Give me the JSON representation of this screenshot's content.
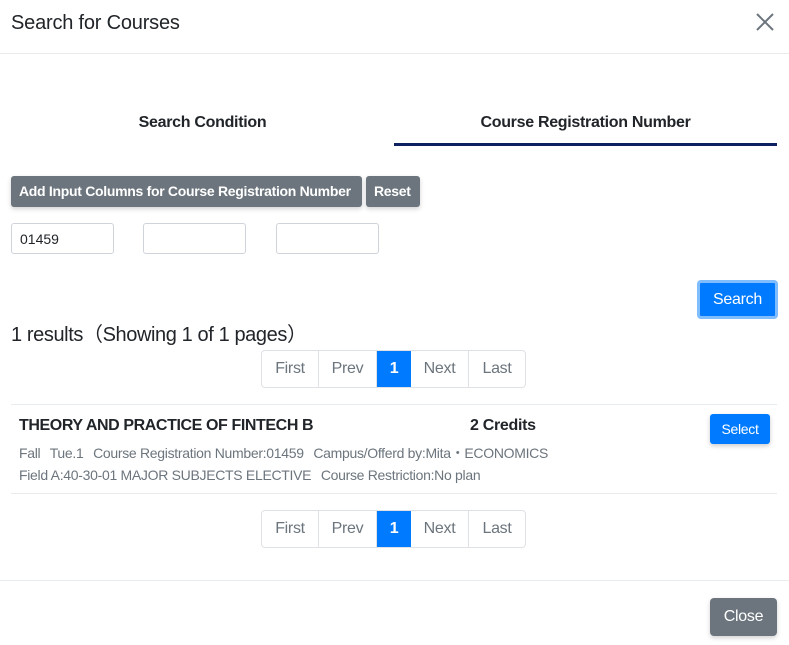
{
  "modal": {
    "title": "Search for Courses",
    "close_icon": "close-x-icon"
  },
  "tabs": [
    {
      "label": "Search Condition",
      "active": false
    },
    {
      "label": "Course Registration Number",
      "active": true
    }
  ],
  "toolbar": {
    "add_columns_label": "Add Input Columns for Course Registration Number",
    "reset_label": "Reset"
  },
  "inputs": [
    {
      "value": "01459",
      "placeholder": ""
    },
    {
      "value": "",
      "placeholder": ""
    },
    {
      "value": "",
      "placeholder": ""
    }
  ],
  "search": {
    "label": "Search"
  },
  "results": {
    "summary": "1 results（Showing 1 of 1 pages）"
  },
  "pagination": {
    "first": "First",
    "prev": "Prev",
    "current": "1",
    "next": "Next",
    "last": "Last"
  },
  "courses": [
    {
      "title": "THEORY AND PRACTICE OF FINTECH B",
      "credits": "2 Credits",
      "term": "Fall",
      "period": "Tue.1",
      "registration_number": "Course Registration Number:01459",
      "campus": "Campus/Offerd by:Mita・ECONOMICS",
      "field": "Field A:40-30-01 MAJOR SUBJECTS ELECTIVE",
      "restriction": "Course Restriction:No plan",
      "select_label": "Select"
    }
  ],
  "footer": {
    "close_label": "Close"
  },
  "colors": {
    "primary": "#007bff",
    "secondary": "#6c757d",
    "tab_underline": "#0d2163"
  }
}
